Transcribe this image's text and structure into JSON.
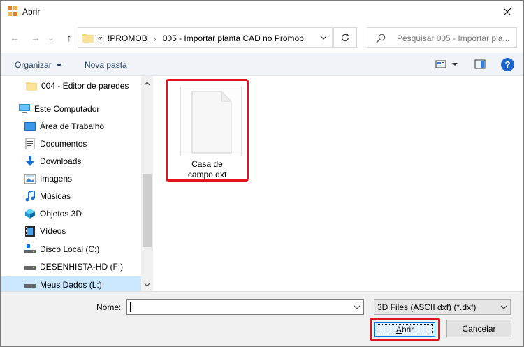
{
  "window": {
    "title": "Abrir"
  },
  "navigation": {
    "back_glyph": "←",
    "forward_glyph": "→",
    "dropdown_glyph": "⌄",
    "up_glyph": "↑",
    "breadcrumb_prefix": "«",
    "breadcrumbs": [
      "!PROMOB",
      "005 - Importar planta CAD no Promob"
    ],
    "separator": "›",
    "search_placeholder": "Pesquisar 005 - Importar pla..."
  },
  "command_bar": {
    "organize_label": "Organizar",
    "new_folder_label": "Nova pasta",
    "help_label": "?"
  },
  "nav_pane": {
    "items": [
      {
        "label": "004 - Editor de paredes",
        "icon": "folder-icon"
      },
      {
        "label": "Este Computador",
        "icon": "computer-icon"
      },
      {
        "label": "Área de Trabalho",
        "icon": "desktop-icon"
      },
      {
        "label": "Documentos",
        "icon": "documents-icon"
      },
      {
        "label": "Downloads",
        "icon": "downloads-icon"
      },
      {
        "label": "Imagens",
        "icon": "images-icon"
      },
      {
        "label": "Músicas",
        "icon": "music-icon"
      },
      {
        "label": "Objetos 3D",
        "icon": "3d-objects-icon"
      },
      {
        "label": "Vídeos",
        "icon": "videos-icon"
      },
      {
        "label": "Disco Local (C:)",
        "icon": "local-disk-icon"
      },
      {
        "label": "DESENHISTA-HD (F:)",
        "icon": "drive-icon"
      },
      {
        "label": "Meus Dados (L:)",
        "icon": "drive-icon"
      }
    ]
  },
  "files": [
    {
      "name_line1": "Casa de",
      "name_line2": "campo.dxf",
      "icon": "generic-file-icon"
    }
  ],
  "footer": {
    "name_label_prefix": "N",
    "name_label_rest": "ome:",
    "name_value": "",
    "filetype_value": "3D Files (ASCII dxf) (*.dxf)",
    "open_label_prefix": "A",
    "open_label_rest": "brir",
    "cancel_label": "Cancelar"
  },
  "colors": {
    "highlight": "#e0141e",
    "selection": "#cce8ff",
    "accent": "#0078d7"
  }
}
